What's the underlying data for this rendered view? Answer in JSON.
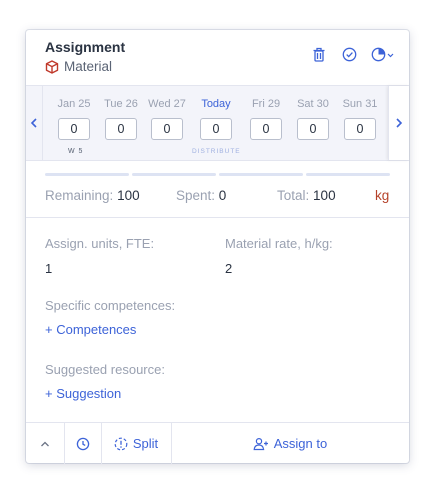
{
  "header": {
    "title": "Assignment",
    "subtitle": "Material"
  },
  "dates": [
    {
      "label": "Jan 25",
      "value": "0"
    },
    {
      "label": "Tue 26",
      "value": "0"
    },
    {
      "label": "Wed 27",
      "value": "0"
    },
    {
      "label": "Today",
      "value": "0"
    },
    {
      "label": "Fri 29",
      "value": "0"
    },
    {
      "label": "Sat 30",
      "value": "0"
    },
    {
      "label": "Sun 31",
      "value": "0"
    }
  ],
  "week_label": "W 5",
  "distribute_label": "DISTRIBUTE",
  "totals": {
    "remaining_label": "Remaining:",
    "remaining_value": "100",
    "spent_label": "Spent:",
    "spent_value": "0",
    "total_label": "Total:",
    "total_value": "100",
    "unit": "kg"
  },
  "fields": {
    "units_label": "Assign. units, FTE:",
    "units_value": "1",
    "rate_label": "Material rate, h/kg:",
    "rate_value": "2",
    "competences_label": "Specific competences:",
    "competences_link": "+ Competences",
    "resource_label": "Suggested resource:",
    "resource_link": "+ Suggestion"
  },
  "footer": {
    "split_label": "Split",
    "assign_label": "Assign to"
  },
  "colors": {
    "accent": "#3d63d8",
    "unit": "#b5432b",
    "material_icon": "#c0392b"
  }
}
